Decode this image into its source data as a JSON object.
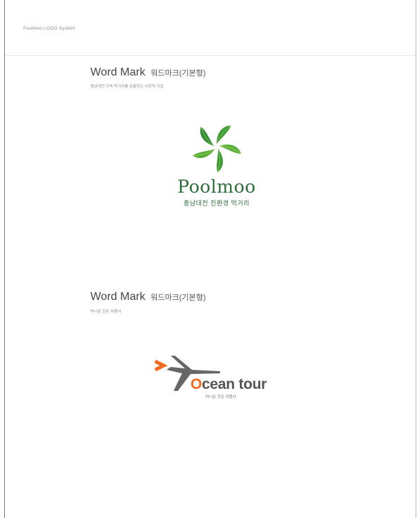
{
  "header": {
    "title": "Poolmoo LOGO System"
  },
  "sections": [
    {
      "title": "Word Mark",
      "title_kr": "워드마크(기본형)",
      "subtitle": "충남대전 지역 먹거리를 유통하는 사회적 기업",
      "logo": {
        "name": "Poolmoo",
        "tagline": "충남대전 친환경 먹거리",
        "brand_color": "#2e6e3a",
        "leaf_colors": [
          "#3f9a3a",
          "#7cc243"
        ]
      }
    },
    {
      "title": "Word Mark",
      "title_kr": "워드마크(기본형)",
      "subtitle": "허니문 전문 여행사",
      "logo": {
        "name_first": "O",
        "name_rest": "cean tour",
        "tagline": "허니문 전문 여행사",
        "accent_color": "#f26a21",
        "text_color": "#555555"
      }
    }
  ]
}
